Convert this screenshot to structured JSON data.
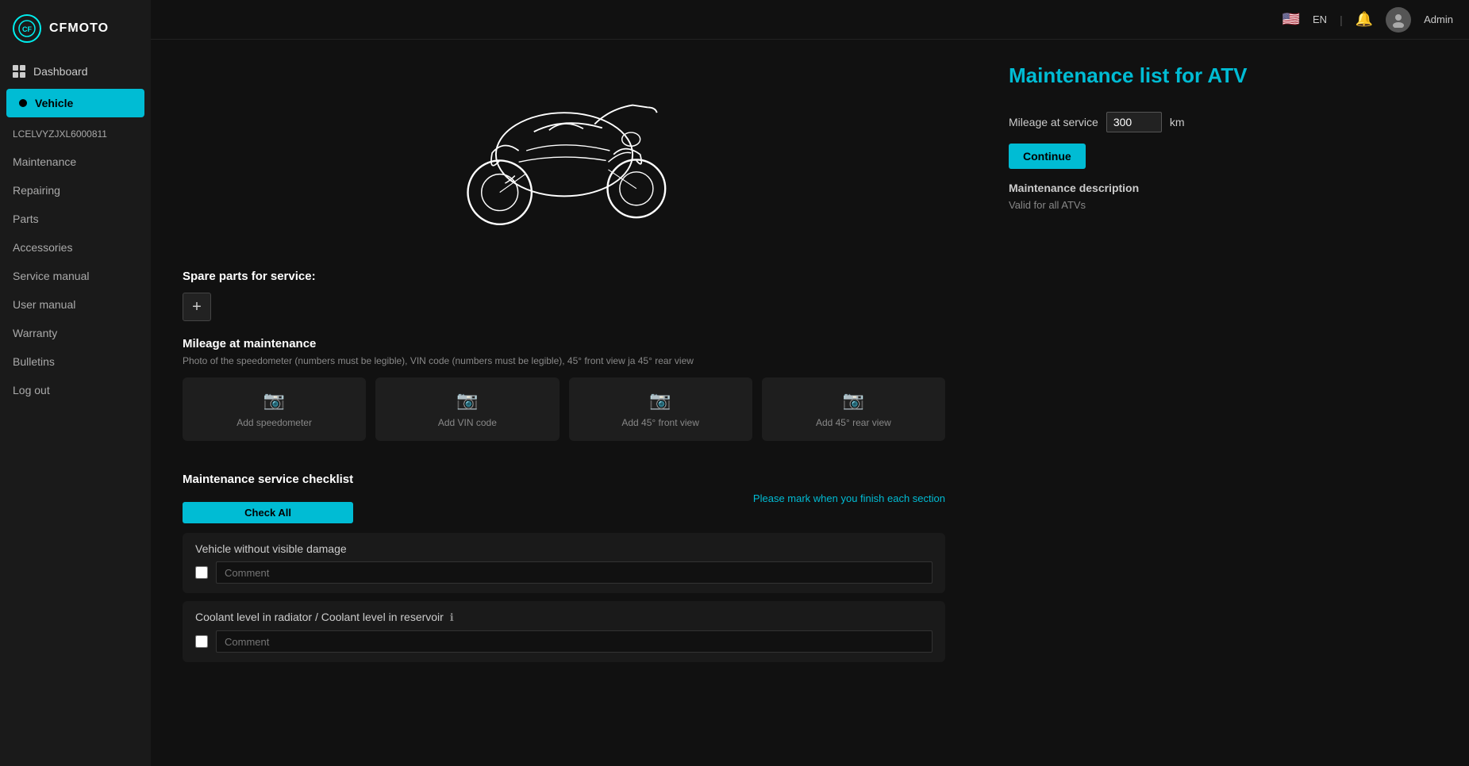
{
  "app": {
    "logo_text": "CFMOTO",
    "language": "EN",
    "admin_label": "Admin"
  },
  "sidebar": {
    "dashboard_label": "Dashboard",
    "vehicle_label": "Vehicle",
    "vin": "LCELVYZJXL6000811",
    "nav_items": [
      {
        "id": "maintenance",
        "label": "Maintenance"
      },
      {
        "id": "repairing",
        "label": "Repairing"
      },
      {
        "id": "parts",
        "label": "Parts"
      },
      {
        "id": "accessories",
        "label": "Accessories"
      },
      {
        "id": "service-manual",
        "label": "Service manual"
      },
      {
        "id": "user-manual",
        "label": "User manual"
      },
      {
        "id": "warranty",
        "label": "Warranty"
      },
      {
        "id": "bulletins",
        "label": "Bulletins"
      },
      {
        "id": "log-out",
        "label": "Log out"
      }
    ]
  },
  "right_panel": {
    "title": "Maintenance list for ATV",
    "mileage_label": "Mileage at service",
    "mileage_value": "300",
    "mileage_unit": "km",
    "continue_label": "Continue",
    "description_title": "Maintenance description",
    "description_text": "Valid for all ATVs"
  },
  "spare_parts": {
    "title": "Spare parts for service:",
    "add_icon": "+"
  },
  "mileage_maintenance": {
    "title": "Mileage at maintenance",
    "description": "Photo of the speedometer (numbers must be legible), VIN code (numbers must be legible), 45° front view ja 45° rear view",
    "photos": [
      {
        "id": "speedometer",
        "label": "Add speedometer"
      },
      {
        "id": "vin-code",
        "label": "Add VIN code"
      },
      {
        "id": "front-view",
        "label": "Add 45° front view"
      },
      {
        "id": "rear-view",
        "label": "Add 45° rear view"
      }
    ]
  },
  "checklist": {
    "title": "Maintenance service checklist",
    "check_all_label": "Check All",
    "please_mark_text": "Please mark when you finish each section",
    "items": [
      {
        "id": "no-damage",
        "title": "Vehicle without visible damage",
        "comment_placeholder": "Comment"
      },
      {
        "id": "coolant",
        "title": "Coolant level in radiator / Coolant level in reservoir",
        "has_info": true,
        "comment_placeholder": "Comment"
      }
    ]
  }
}
